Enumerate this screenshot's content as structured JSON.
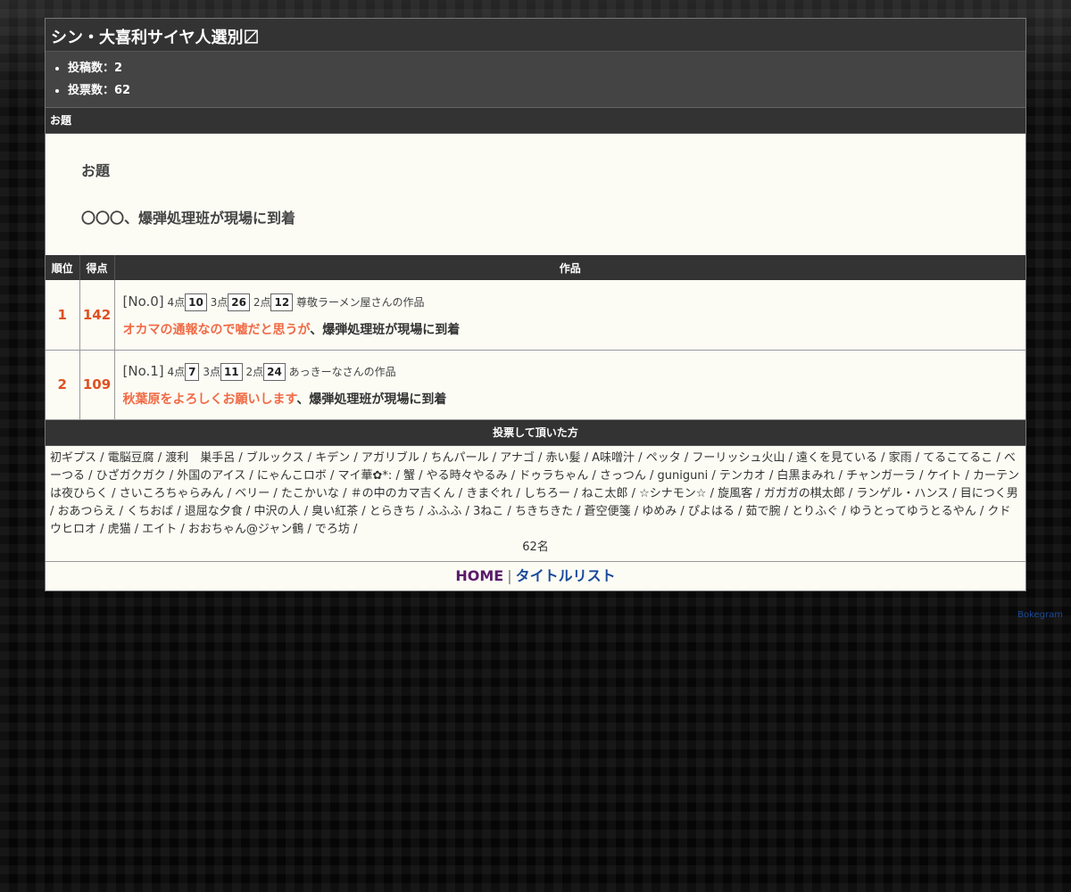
{
  "page": {
    "title": "シン・大喜利サイヤ人選別〼",
    "stats": [
      "投稿数：2",
      "投票数：62"
    ]
  },
  "odai_section": {
    "header": "お題",
    "label": "お題",
    "text": "〇〇〇、爆弾処理班が現場に到着"
  },
  "ranking": {
    "columns": [
      "順位",
      "得点",
      "作品"
    ],
    "rows": [
      {
        "rank": "1",
        "score": "142",
        "no": "[No.0]",
        "p4_label": "4点",
        "p4": "10",
        "p3_label": "3点",
        "p3": "26",
        "p2_label": "2点",
        "p2": "12",
        "author": "尊敬ラーメン屋さんの作品",
        "highlight": "オカマの通報なので嘘だと思うが",
        "rest": "、爆弾処理班が現場に到着"
      },
      {
        "rank": "2",
        "score": "109",
        "no": "[No.1]",
        "p4_label": "4点",
        "p4": "7",
        "p3_label": "3点",
        "p3": "11",
        "p2_label": "2点",
        "p2": "24",
        "author": "あっきーなさんの作品",
        "highlight": "秋葉原をよろしくお願いします",
        "rest": "、爆弾処理班が現場に到着"
      }
    ]
  },
  "voters": {
    "header": "投票して頂いた方",
    "list": "初ギプス / 電脳豆腐 / 渡利　巣手呂 / ブルックス / キデン / アガリブル / ちんパール / アナゴ / 赤い髪 / A味噌汁 / ペッタ / フーリッシュ火山 / 遠くを見ている / 家雨 / てるこてるこ / べーつる / ひざガクガク / 外国のアイス / にゃんこロボ / マイ華✿*: / 蟹 / やる時々やるみ / ドゥラちゃん / さっつん / guniguni / テンカオ / 白黒まみれ / チャンガーラ / ケイト / カーテンは夜ひらく / さいころちゃらみん / ベリー / たこかいな / ＃の中のカマ吉くん / きまぐれ / しちろー / ねこ太郎 / ☆シナモン☆ / 旋風客 / ガガガの棋太郎 / ランゲル・ハンス / 目につく男 / おあつらえ / くちおば / 退屈な夕食 / 中沢の人 / 臭い紅茶 / とらきち / ふふふ / 3ねこ / ちきちきた / 蒼空便箋 / ゆめみ / ぴよはる / 茹で腕 / とりふぐ / ゆうとってゆうとるやん / クドウヒロオ / 虎猫 / エイト / おおちゃん@ジャン鶴 / でろ坊 /",
    "count": "62名"
  },
  "footer": {
    "home": "HOME",
    "separator": "|",
    "title_list": "タイトルリスト"
  },
  "credit": "Bokegram",
  "colors": {
    "accent_orange": "#e05020",
    "highlight_orange": "#f06a45",
    "header_dark": "#333333",
    "link_purple": "#5a1a6a",
    "link_blue": "#1a4a9a"
  }
}
